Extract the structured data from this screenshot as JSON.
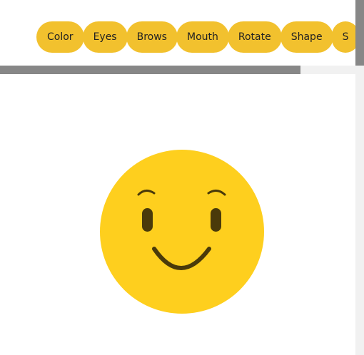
{
  "toolbar": {
    "tabs": [
      {
        "id": "color",
        "label": "Color"
      },
      {
        "id": "eyes",
        "label": "Eyes"
      },
      {
        "id": "brows",
        "label": "Brows"
      },
      {
        "id": "mouth",
        "label": "Mouth"
      },
      {
        "id": "rotate",
        "label": "Rotate"
      },
      {
        "id": "shape",
        "label": "Shape"
      },
      {
        "id": "s-partial",
        "label": "S"
      }
    ]
  },
  "emoji": {
    "face_color": "#fecf1e",
    "feature_color": "#4a3a0a"
  },
  "colors": {
    "tab_background": "#f2c12e",
    "scroll_thumb": "#878787",
    "scroll_track": "#f1f1f1"
  }
}
